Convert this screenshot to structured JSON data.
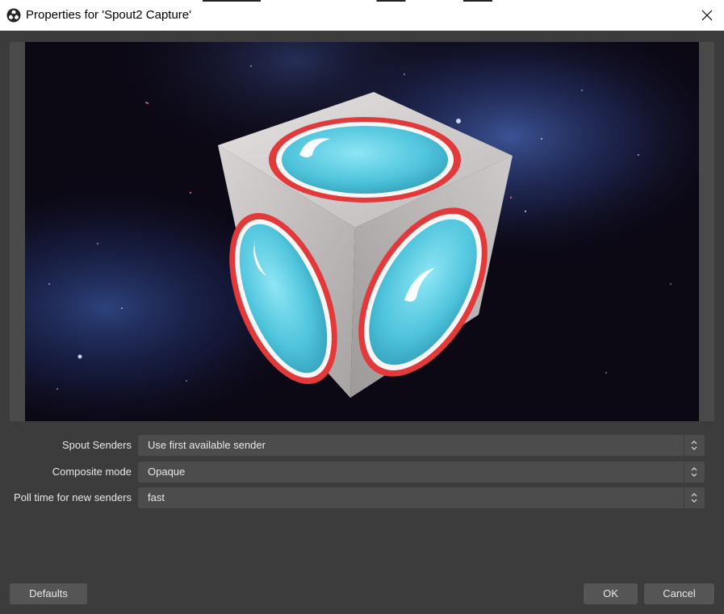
{
  "window": {
    "title": "Properties for 'Spout2 Capture'",
    "app_icon": "obs-logo-icon",
    "close_icon": "close-icon"
  },
  "preview": {
    "content": "spout-sender-preview"
  },
  "properties": [
    {
      "label": "Spout Senders",
      "value": "Use first available sender"
    },
    {
      "label": "Composite mode",
      "value": "Opaque"
    },
    {
      "label": "Poll time for new senders",
      "value": "fast"
    }
  ],
  "buttons": {
    "defaults": "Defaults",
    "ok": "OK",
    "cancel": "Cancel"
  },
  "colors": {
    "window_bg": "#3c3c3c",
    "field_bg": "#4c4c4c",
    "button_bg": "#555555",
    "text": "#e8e8e8"
  }
}
